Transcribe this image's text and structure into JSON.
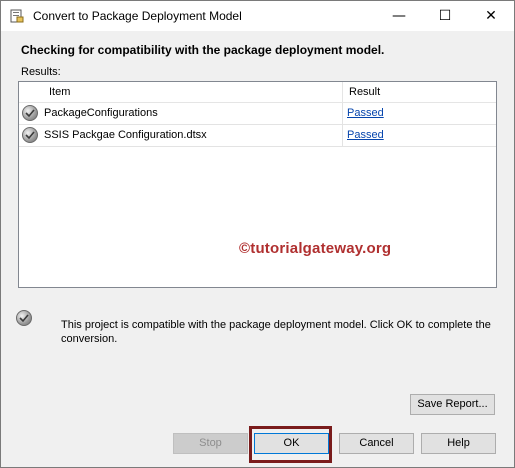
{
  "window": {
    "title": "Convert to Package Deployment Model",
    "minimize_glyph": "—",
    "maximize_glyph": "☐",
    "close_glyph": "✕"
  },
  "heading": "Checking for compatibility with the package deployment model.",
  "results": {
    "label": "Results:",
    "columns": [
      "Item",
      "Result"
    ],
    "rows": [
      {
        "item": "PackageConfigurations",
        "result": "Passed",
        "icon": "passed-check-icon"
      },
      {
        "item": "SSIS Packgae Configuration.dtsx",
        "result": "Passed",
        "icon": "passed-check-icon"
      }
    ]
  },
  "watermark": "©tutorialgateway.org",
  "status": {
    "icon": "passed-check-icon",
    "message": "This project is compatible with the package deployment model. Click OK to complete the conversion."
  },
  "buttons": {
    "save_report": "Save Report...",
    "stop": "Stop",
    "ok": "OK",
    "cancel": "Cancel",
    "help": "Help"
  },
  "colors": {
    "link": "#0645ad",
    "watermark": "#b03030",
    "highlight": "#7a1c1c"
  }
}
